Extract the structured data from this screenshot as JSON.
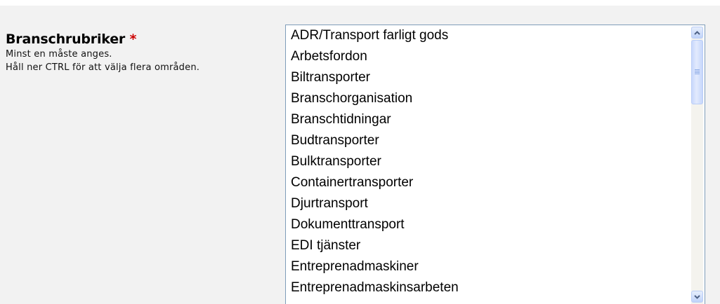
{
  "field": {
    "label": "Branschrubriker",
    "required_marker": "*",
    "hint_line1": "Minst en måste anges.",
    "hint_line2": "Håll ner CTRL för att välja flera områden."
  },
  "listbox": {
    "options": [
      "ADR/Transport farligt gods",
      "Arbetsfordon",
      "Biltransporter",
      "Branschorganisation",
      "Branschtidningar",
      "Budtransporter",
      "Bulktransporter",
      "Containertransporter",
      "Djurtransport",
      "Dokumenttransport",
      "EDI tjänster",
      "Entreprenadmaskiner",
      "Entreprenadmaskinsarbeten"
    ],
    "scroll_position": 0
  },
  "colors": {
    "panel_bg": "#f2f2f2",
    "required_star": "#cc0000",
    "listbox_border": "#7f9db9"
  },
  "icons": {
    "scroll_up": "chevron-up-icon",
    "scroll_down": "chevron-down-icon"
  }
}
